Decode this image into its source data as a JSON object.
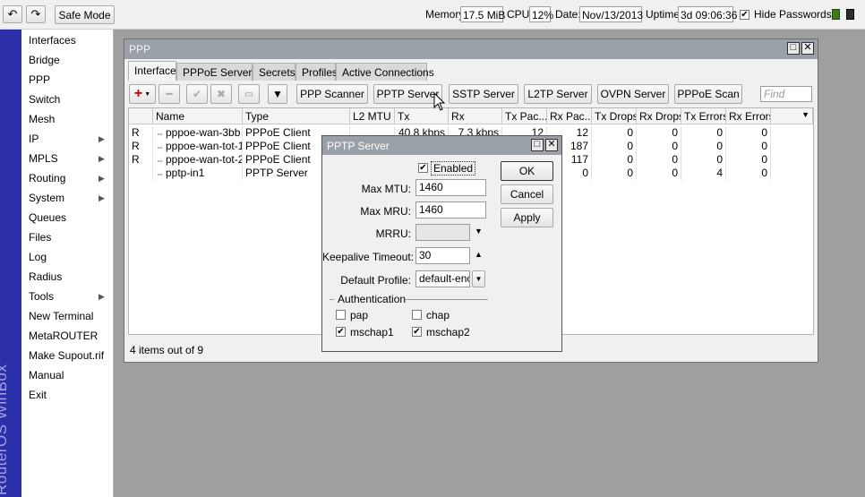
{
  "toolbar": {
    "safe_mode_label": "Safe Mode",
    "memory_label": "Memory:",
    "memory_value": "17.5 MiB",
    "cpu_label": "CPU:",
    "cpu_value": "12%",
    "date_label": "Date:",
    "date_value": "Nov/13/2013",
    "uptime_label": "Uptime:",
    "uptime_value": "3d 09:06:36",
    "hide_passwords_label": "Hide Passwords",
    "status_colors": [
      "#3a7a1a",
      "#2b2b2b"
    ]
  },
  "brand": "RouterOS WinBox",
  "menu": [
    {
      "label": "Interfaces",
      "arrow": false
    },
    {
      "label": "Bridge",
      "arrow": false
    },
    {
      "label": "PPP",
      "arrow": false
    },
    {
      "label": "Switch",
      "arrow": false
    },
    {
      "label": "Mesh",
      "arrow": false
    },
    {
      "label": "IP",
      "arrow": true
    },
    {
      "label": "MPLS",
      "arrow": true
    },
    {
      "label": "Routing",
      "arrow": true
    },
    {
      "label": "System",
      "arrow": true
    },
    {
      "label": "Queues",
      "arrow": false
    },
    {
      "label": "Files",
      "arrow": false
    },
    {
      "label": "Log",
      "arrow": false
    },
    {
      "label": "Radius",
      "arrow": false
    },
    {
      "label": "Tools",
      "arrow": true
    },
    {
      "label": "New Terminal",
      "arrow": false
    },
    {
      "label": "MetaROUTER",
      "arrow": false
    },
    {
      "label": "Make Supout.rif",
      "arrow": false
    },
    {
      "label": "Manual",
      "arrow": false
    },
    {
      "label": "Exit",
      "arrow": false
    }
  ],
  "ppp": {
    "title": "PPP",
    "tabs": [
      "Interface",
      "PPPoE Servers",
      "Secrets",
      "Profiles",
      "Active Connections"
    ],
    "buttons": [
      "PPP Scanner",
      "PPTP Server",
      "SSTP Server",
      "L2TP Server",
      "OVPN Server",
      "PPPoE Scan"
    ],
    "find_placeholder": "Find",
    "columns": [
      "",
      "Name",
      "Type",
      "L2 MTU",
      "Tx",
      "Rx",
      "Tx Pac...",
      "Rx Pac...",
      "Tx Drops",
      "Rx Drops",
      "Tx Errors",
      "Rx Errors"
    ],
    "rows": [
      [
        "R",
        "pppoe-wan-3bb",
        "PPPoE Client",
        "",
        "40.8 kbps",
        "7.3 kbps",
        "12",
        "12",
        "0",
        "0",
        "0",
        "0"
      ],
      [
        "R",
        "pppoe-wan-tot-1",
        "PPPoE Client",
        "",
        "",
        "",
        "",
        "187",
        "0",
        "0",
        "0",
        "0"
      ],
      [
        "R",
        "pppoe-wan-tot-2",
        "PPPoE Client",
        "",
        "",
        "",
        "",
        "117",
        "0",
        "0",
        "0",
        "0"
      ],
      [
        "",
        "pptp-in1",
        "PPTP Server",
        "",
        "",
        "",
        "",
        "0",
        "0",
        "0",
        "4",
        "0"
      ]
    ],
    "status": "4 items out of 9"
  },
  "dialog": {
    "title": "PPTP Server",
    "enabled_label": "Enabled",
    "enabled": true,
    "max_mtu_label": "Max MTU:",
    "max_mtu": "1460",
    "max_mru_label": "Max MRU:",
    "max_mru": "1460",
    "mrru_label": "MRRU:",
    "mrru": "",
    "keepalive_label": "Keepalive Timeout:",
    "keepalive": "30",
    "default_profile_label": "Default Profile:",
    "default_profile": "default-encr",
    "authentication_label": "Authentication",
    "auth": [
      {
        "label": "pap",
        "checked": false
      },
      {
        "label": "chap",
        "checked": false
      },
      {
        "label": "mschap1",
        "checked": true
      },
      {
        "label": "mschap2",
        "checked": true
      }
    ],
    "ok_label": "OK",
    "cancel_label": "Cancel",
    "apply_label": "Apply"
  }
}
